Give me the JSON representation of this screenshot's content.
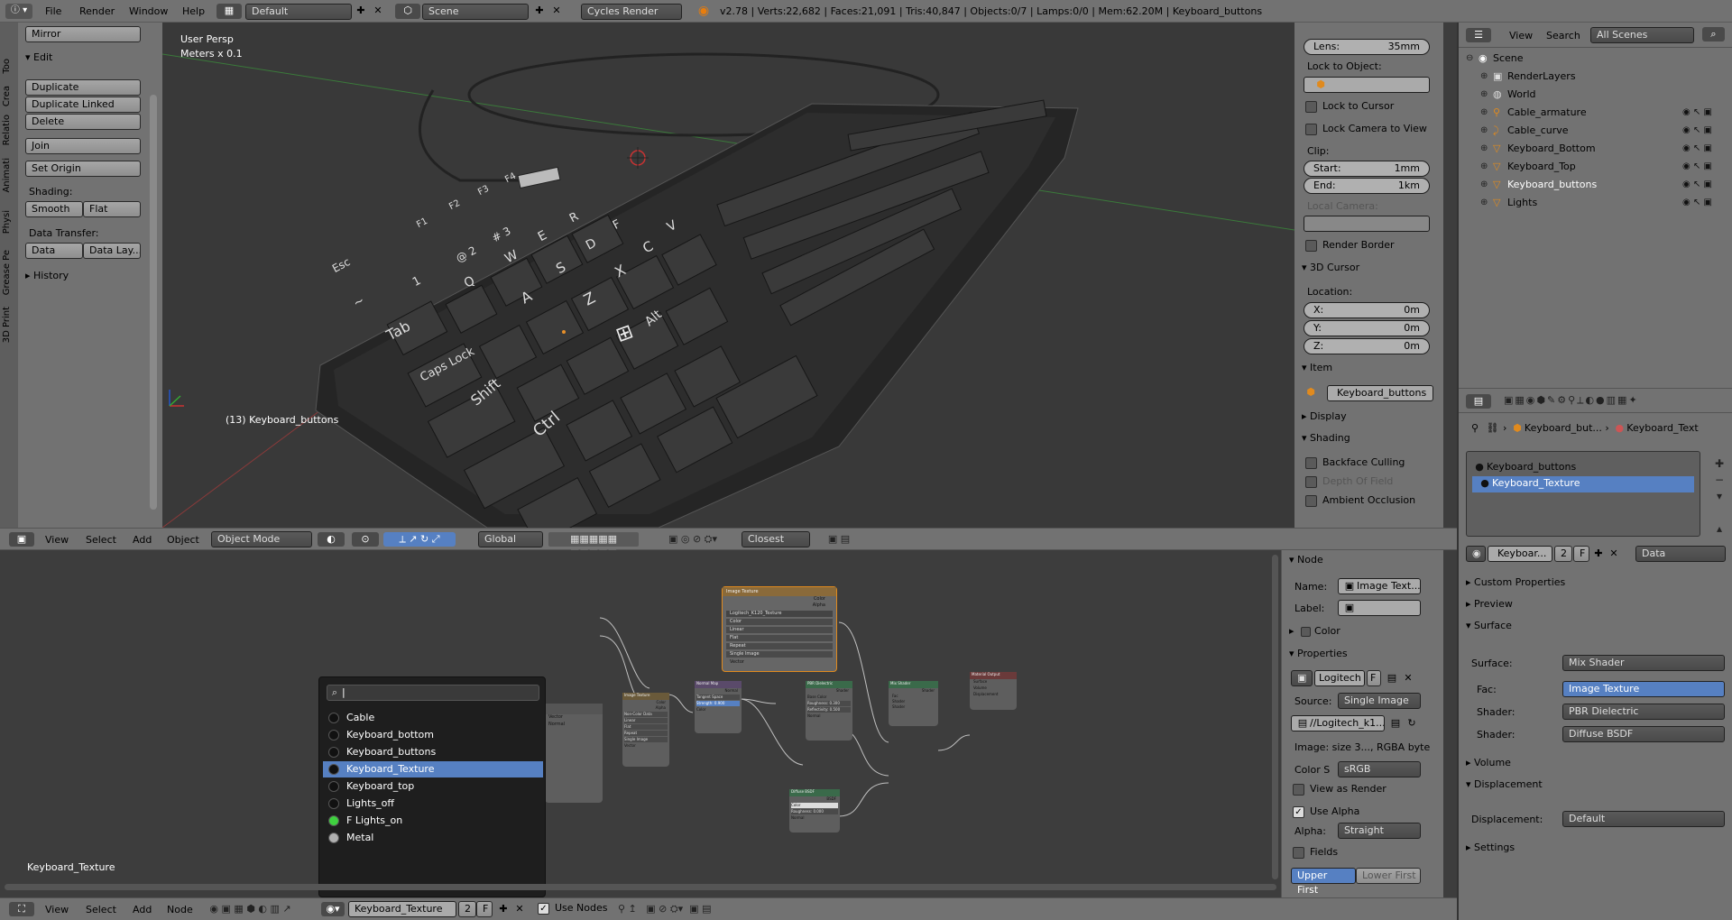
{
  "top_menu": {
    "items": [
      "File",
      "Render",
      "Window",
      "Help"
    ],
    "layout": "Default",
    "scene": "Scene",
    "engine": "Cycles Render",
    "stats": "v2.78 | Verts:22,682 | Faces:21,091 | Tris:40,847 | Objects:0/7 | Lamps:0/0 | Mem:62.20M | Keyboard_buttons"
  },
  "tool_tabs": [
    "Too",
    "Crea",
    "Relatio",
    "Animati",
    "Physi",
    "Grease Pe",
    "3D Print"
  ],
  "tool_panel": {
    "mirror": "Mirror",
    "edit_header": "Edit",
    "duplicate": "Duplicate",
    "duplicate_linked": "Duplicate Linked",
    "delete": "Delete",
    "join": "Join",
    "set_origin": "Set Origin",
    "shading_label": "Shading:",
    "smooth": "Smooth",
    "flat": "Flat",
    "data_transfer_label": "Data Transfer:",
    "data": "Data",
    "data_lay": "Data Lay...",
    "history": "History"
  },
  "viewport": {
    "view_name": "User Persp",
    "units": "Meters x 0.1",
    "selected": "(13) Keyboard_buttons",
    "menu": [
      "View",
      "Select",
      "Add",
      "Object"
    ],
    "mode": "Object Mode",
    "orientation": "Global",
    "snap": "Closest"
  },
  "n_panel": {
    "lens_label": "Lens:",
    "lens_value": "35mm",
    "lock_to_object": "Lock to Object:",
    "lock_to_cursor": "Lock to Cursor",
    "lock_camera": "Lock Camera to View",
    "clip": "Clip:",
    "clip_start_label": "Start:",
    "clip_start": "1mm",
    "clip_end_label": "End:",
    "clip_end": "1km",
    "local_camera": "Local Camera:",
    "render_border": "Render Border",
    "cursor_header": "3D Cursor",
    "location": "Location:",
    "x_label": "X:",
    "x": "0m",
    "y_label": "Y:",
    "y": "0m",
    "z_label": "Z:",
    "z": "0m",
    "item_header": "Item",
    "item_name": "Keyboard_buttons",
    "display_header": "Display",
    "shading_header": "Shading",
    "backface": "Backface Culling",
    "dof": "Depth Of Field",
    "ao": "Ambient Occlusion"
  },
  "outliner": {
    "menu": [
      "View",
      "Search"
    ],
    "filter": "All Scenes",
    "items": [
      {
        "label": "Scene",
        "depth": 0
      },
      {
        "label": "RenderLayers",
        "depth": 1
      },
      {
        "label": "World",
        "depth": 1
      },
      {
        "label": "Cable_armature",
        "depth": 1
      },
      {
        "label": "Cable_curve",
        "depth": 1
      },
      {
        "label": "Keyboard_Bottom",
        "depth": 1
      },
      {
        "label": "Keyboard_Top",
        "depth": 1
      },
      {
        "label": "Keyboard_buttons",
        "depth": 1
      },
      {
        "label": "Lights",
        "depth": 1
      }
    ]
  },
  "properties": {
    "breadcrumb_object": "Keyboard_but...",
    "breadcrumb_material": "Keyboard_Text",
    "materials": [
      "Keyboard_buttons",
      "Keyboard_Texture"
    ],
    "selected_material": "Keyboard_Texture",
    "material_name": "Keyboar...",
    "users": "2",
    "fake": "F",
    "data_link": "Data",
    "custom_properties": "Custom Properties",
    "preview": "Preview",
    "surface_header": "Surface",
    "surface_label": "Surface:",
    "surface_value": "Mix Shader",
    "fac_label": "Fac:",
    "fac_value": "Image Texture",
    "shader1_label": "Shader:",
    "shader1_value": "PBR Dielectric",
    "shader2_label": "Shader:",
    "shader2_value": "Diffuse BSDF",
    "volume": "Volume",
    "displacement_header": "Displacement",
    "displacement_label": "Displacement:",
    "displacement_value": "Default",
    "settings": "Settings"
  },
  "node_editor": {
    "material_label": "Keyboard_Texture",
    "menu": [
      "View",
      "Select",
      "Add",
      "Node"
    ],
    "material_field": "Keyboard_Texture",
    "users": "2",
    "fake": "F",
    "use_nodes": "Use Nodes",
    "dropdown_items": [
      {
        "label": "Cable",
        "color": "#111111"
      },
      {
        "label": "Keyboard_bottom",
        "color": "#111111"
      },
      {
        "label": "Keyboard_buttons",
        "color": "#111111"
      },
      {
        "label": "Keyboard_Texture",
        "color": "#111111"
      },
      {
        "label": "Keyboard_top",
        "color": "#111111"
      },
      {
        "label": "Lights_off",
        "color": "#111111"
      },
      {
        "label": "F Lights_on",
        "color": "#3fd13f"
      },
      {
        "label": "Metal",
        "color": "#b0b0b0"
      }
    ],
    "dropdown_selected": "Keyboard_Texture"
  },
  "node_panel": {
    "node_header": "Node",
    "name_label": "Name:",
    "name_value": "Image Text...",
    "label_label": "Label:",
    "color_header": "Color",
    "properties_header": "Properties",
    "image_name": "Logitech",
    "image_fake": "F",
    "source_label": "Source:",
    "source_value": "Single Image",
    "filepath": "//Logitech_k1...",
    "image_info": "Image: size 3..., RGBA byte",
    "colorspace_label": "Color S",
    "colorspace_value": "sRGB",
    "view_as_render": "View as Render",
    "use_alpha": "Use Alpha",
    "alpha_label": "Alpha:",
    "alpha_value": "Straight",
    "fields": "Fields",
    "upper_first": "Upper First",
    "lower_first": "Lower First"
  },
  "nodes": {
    "image_texture": {
      "title": "Image Texture",
      "outputs": [
        "Color",
        "Alpha"
      ],
      "rows": [
        "Logitech_K120_Texture",
        "Color",
        "Linear",
        "Flat",
        "Repeat",
        "Single Image",
        "Vector"
      ]
    },
    "image_texture2": {
      "title": "Image Texture",
      "outputs": [
        "Color",
        "Alpha"
      ],
      "rows": [
        "Non-Color Data",
        "Linear",
        "Flat",
        "Repeat",
        "Single Image",
        "Vector"
      ]
    },
    "normal_map": {
      "title": "Normal Map",
      "outputs": [
        "Normal"
      ],
      "rows": [
        "Tangent Space",
        "Strength: 0.900",
        "Color"
      ]
    },
    "pbr": {
      "title": "PBR Dielectric",
      "outputs": [
        "Shader"
      ],
      "rows": [
        "Base Color",
        "Roughness: 0.300",
        "Reflectivity: 0.500",
        "Normal"
      ]
    },
    "diffuse": {
      "title": "Diffuse BSDF",
      "outputs": [
        "BSDF"
      ],
      "rows": [
        "Color",
        "Roughness: 0.000",
        "Normal"
      ]
    },
    "mix": {
      "title": "Mix Shader",
      "outputs": [
        "Shader"
      ],
      "rows": [
        "Fac",
        "Shader",
        "Shader"
      ]
    },
    "output": {
      "title": "Material Output",
      "rows": [
        "Surface",
        "Volume",
        "Displacement"
      ]
    },
    "texcoord": {
      "rows": [
        "Vector",
        "Normal"
      ]
    }
  },
  "keyboard": {
    "keys": [
      "Esc",
      "Tab",
      "Caps Lock",
      "Shift",
      "Ctrl",
      "Alt",
      "Q",
      "W",
      "E",
      "R",
      "A",
      "S",
      "D",
      "F",
      "Z",
      "X",
      "C",
      "V",
      "~",
      "1",
      "@ 2",
      "# 3",
      "F1",
      "F2",
      "F3",
      "F4"
    ]
  },
  "colors": {
    "header_bg": "#727272",
    "viewport_bg": "#393939",
    "node_bg": "#3d3d3d",
    "selected": "#5680c2",
    "node_selected_border": "#e08a1e"
  }
}
